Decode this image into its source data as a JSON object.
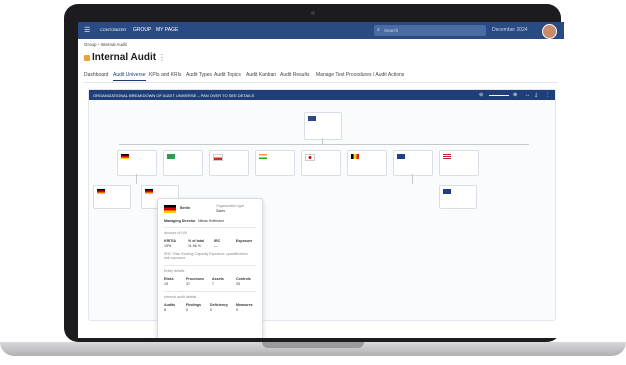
{
  "topbar": {
    "app_name": "GROUP",
    "app_sub": "MY PAGE",
    "search_placeholder": "Search",
    "date": "December 2024"
  },
  "breadcrumb": [
    "Group",
    "Internal Audit"
  ],
  "page_title": "Internal Audit",
  "tabs": [
    "Dashboard",
    "Audit Universe",
    "KPIs and KRIs",
    "Audit Types",
    "Audit Topics",
    "Audit Kanban",
    "Audit Results",
    "Manage Test Procedures / Audit Actions"
  ],
  "active_tab": "Audit Universe",
  "panel_title": "ORGANIZATIONAL BREAKDOWN OF AUDIT UNIVERSE – PAN OVER TO SEE DETAILS",
  "popup": {
    "entity": "Berlin",
    "org_type_label": "Organization type",
    "org_type": "Sales",
    "managing_director_label": "Managing Director",
    "managing_director": "Niklas Hoffmann",
    "section1": "Amount of IVA",
    "kpis": [
      {
        "k": "KRITIA",
        "v": "19%"
      },
      {
        "k": "% of total",
        "v": "11.56 %"
      },
      {
        "k": "IRC",
        "v": "—"
      },
      {
        "k": "Exposure",
        "v": ""
      }
    ],
    "note": "IRIC: Risk Scoring Capacity Exposure: quantification risk exposure",
    "section2": "Entity details",
    "details": [
      {
        "k": "Risks",
        "v": "19"
      },
      {
        "k": "Processes",
        "v": "37"
      },
      {
        "k": "Assets",
        "v": "7"
      },
      {
        "k": "Controls",
        "v": "25"
      }
    ],
    "section3": "Internal audit details",
    "audit": [
      {
        "k": "Audits",
        "v": "8"
      },
      {
        "k": "Findings",
        "v": "0"
      },
      {
        "k": "Deficiency",
        "v": "0"
      },
      {
        "k": "Measures",
        "v": "0"
      }
    ]
  },
  "colors": {
    "primary": "#2a4a85",
    "accent": "#e8a33d"
  }
}
